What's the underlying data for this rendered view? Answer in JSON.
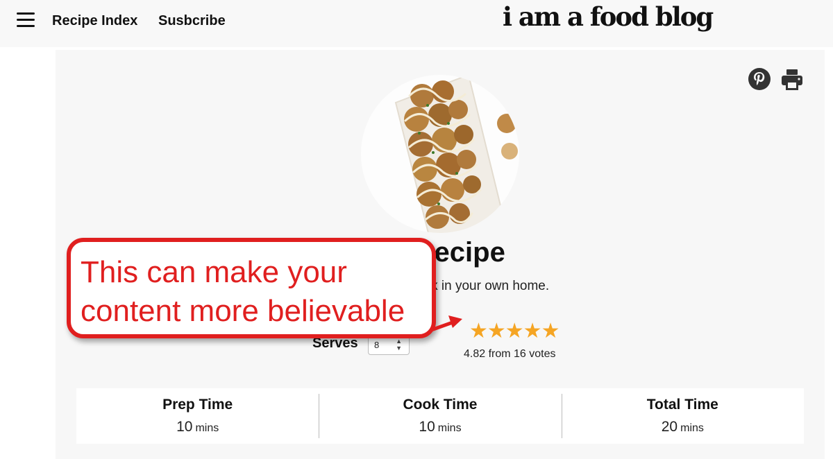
{
  "header": {
    "menu_icon": "hamburger-menu-icon",
    "nav": [
      {
        "label": "Recipe Index"
      },
      {
        "label": "Susbcribe"
      }
    ],
    "logo": "i am a food blog"
  },
  "recipe": {
    "title_visible": "ki Recipe",
    "summary_visible": "se street snack in your own home.",
    "image_icon": "takoyaki-dish-photo",
    "share_icons": [
      "pinterest-icon",
      "print-icon"
    ],
    "serves": {
      "label": "Serves",
      "value": "8"
    },
    "rating": {
      "value": 4.82,
      "max": 5,
      "text": "4.82 from 16 votes"
    },
    "times": [
      {
        "label": "Prep Time",
        "value": "10",
        "unit": "mins"
      },
      {
        "label": "Cook Time",
        "value": "10",
        "unit": "mins"
      },
      {
        "label": "Total Time",
        "value": "20",
        "unit": "mins"
      }
    ]
  },
  "annotation": {
    "lines": [
      "This can make your",
      "content more believable"
    ],
    "color": "#e01f1f"
  },
  "colors": {
    "star": "#f5a524",
    "header_bg": "#f8f8f8",
    "card_bg": "#f7f7f7"
  }
}
